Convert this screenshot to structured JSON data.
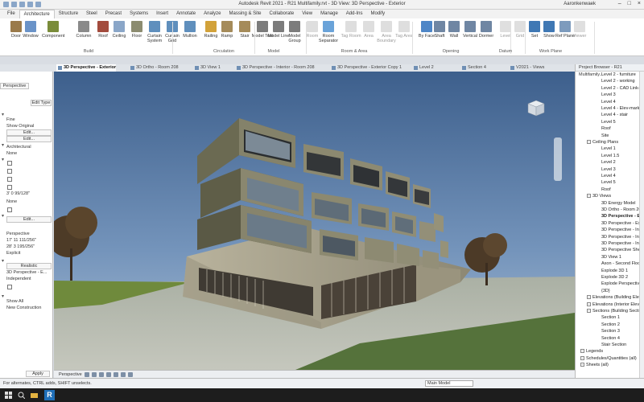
{
  "app": {
    "title": "Autodesk Revit 2021 - R21 Multifamily.rvt - 3D View: 3D Perspective - Exterior",
    "user": "Aaronkenwaek"
  },
  "ribbon_tabs": [
    "File",
    "Architecture",
    "Structure",
    "Steel",
    "Precast",
    "Systems",
    "Insert",
    "Annotate",
    "Analyze",
    "Massing & Site",
    "Collaborate",
    "View",
    "Manage",
    "Add-Ins",
    "Modify"
  ],
  "ribbon": {
    "buttons": [
      {
        "label": "Door"
      },
      {
        "label": "Window"
      },
      {
        "label": "Component"
      },
      {
        "label": "Column"
      },
      {
        "label": "Roof"
      },
      {
        "label": "Ceiling"
      },
      {
        "label": "Floor"
      },
      {
        "label": "Curtain System"
      },
      {
        "label": "Curtain Grid"
      },
      {
        "label": "Mullion"
      },
      {
        "label": "Railing"
      },
      {
        "label": "Ramp"
      },
      {
        "label": "Stair"
      },
      {
        "label": "Model Text"
      },
      {
        "label": "Model Line"
      },
      {
        "label": "Model Group"
      },
      {
        "label": "Room"
      },
      {
        "label": "Room Separator"
      },
      {
        "label": "Tag Room"
      },
      {
        "label": "Area"
      },
      {
        "label": "Area Boundary"
      },
      {
        "label": "Tag Area"
      },
      {
        "label": "By Face"
      },
      {
        "label": "Shaft"
      },
      {
        "label": "Wall"
      },
      {
        "label": "Vertical"
      },
      {
        "label": "Dormer"
      },
      {
        "label": "Level"
      },
      {
        "label": "Grid"
      },
      {
        "label": "Set"
      },
      {
        "label": "Show"
      },
      {
        "label": "Ref Plane"
      },
      {
        "label": "Viewer"
      }
    ],
    "panels": [
      "Build",
      "Circulation",
      "Model",
      "Room & Area",
      "Opening",
      "Datum",
      "Work Plane"
    ]
  },
  "view_tabs": [
    {
      "label": "3D Perspective - Exterior",
      "active": true
    },
    {
      "label": "3D Ortho - Room 208"
    },
    {
      "label": "3D View 1"
    },
    {
      "label": "3D Perspective - Interior - Room 208"
    },
    {
      "label": "3D Perspective - Exterior Copy 1"
    },
    {
      "label": "Level 2"
    },
    {
      "label": "Section 4"
    },
    {
      "label": "V2021 - Views"
    }
  ],
  "properties": {
    "type_label": "Perspective",
    "edit_type": "Edit Type",
    "rows": [
      "Fine",
      "Show Original",
      "Edit...",
      "Edit...",
      "Architectural",
      "None",
      "",
      "",
      "",
      "",
      "3' 0 99/128\"",
      "None",
      "",
      "Edit...",
      "Perspective",
      "17' 11 111/256\"",
      "28' 3 195/256\"",
      "Explicit",
      "Realistic",
      "3D Perspective - E...",
      "Independent",
      "",
      "Show All",
      "New Construction"
    ],
    "apply": "Apply"
  },
  "view_control": {
    "mode": "Perspective"
  },
  "project_browser": {
    "title": "Project Browser - R21 Multifamily...",
    "items": [
      {
        "label": "Level 2 - furniture",
        "indent": 4
      },
      {
        "label": "Level 2 - working",
        "indent": 4
      },
      {
        "label": "Level 2 - CAD Link-se",
        "indent": 4
      },
      {
        "label": "Level 3",
        "indent": 4
      },
      {
        "label": "Level 4",
        "indent": 4
      },
      {
        "label": "Level 4 - Elev-mark",
        "indent": 4
      },
      {
        "label": "Level 4 - stair",
        "indent": 4
      },
      {
        "label": "Level 5",
        "indent": 4
      },
      {
        "label": "Roof",
        "indent": 4
      },
      {
        "label": "Site",
        "indent": 4
      },
      {
        "label": "Ceiling Plans",
        "indent": 2,
        "group": true
      },
      {
        "label": "Level 1",
        "indent": 4
      },
      {
        "label": "Level 1.5",
        "indent": 4
      },
      {
        "label": "Level 2",
        "indent": 4
      },
      {
        "label": "Level 3",
        "indent": 4
      },
      {
        "label": "Level 4",
        "indent": 4
      },
      {
        "label": "Level 5",
        "indent": 4
      },
      {
        "label": "Roof",
        "indent": 4
      },
      {
        "label": "3D Views",
        "indent": 2,
        "group": true
      },
      {
        "label": "3D Energy Model",
        "indent": 4
      },
      {
        "label": "3D Ortho - Room 20",
        "indent": 4
      },
      {
        "label": "3D Perspective - Ex",
        "indent": 4,
        "bold": true
      },
      {
        "label": "3D Perspective - Ext",
        "indent": 4
      },
      {
        "label": "3D Perspective - Inte",
        "indent": 4
      },
      {
        "label": "3D Perspective - Inte",
        "indent": 4
      },
      {
        "label": "3D Perspective - Inte",
        "indent": 4
      },
      {
        "label": "3D Perspective Sheet",
        "indent": 4
      },
      {
        "label": "3D View 1",
        "indent": 4
      },
      {
        "label": "Axon - Second Floor",
        "indent": 4
      },
      {
        "label": "Explode 3D 1",
        "indent": 4
      },
      {
        "label": "Explode 3D 2",
        "indent": 4
      },
      {
        "label": "Explode Perspective",
        "indent": 4
      },
      {
        "label": "{3D}",
        "indent": 4
      },
      {
        "label": "Elevations (Building Elev",
        "indent": 2,
        "group": true
      },
      {
        "label": "Elevations (Interior Eleva",
        "indent": 2,
        "group": true
      },
      {
        "label": "Sections (Building Sectio",
        "indent": 2,
        "group": true
      },
      {
        "label": "Section 1",
        "indent": 4
      },
      {
        "label": "Section 2",
        "indent": 4
      },
      {
        "label": "Section 3",
        "indent": 4
      },
      {
        "label": "Section 4",
        "indent": 4
      },
      {
        "label": "Stair Section",
        "indent": 4
      },
      {
        "label": "Legends",
        "indent": 1,
        "group": true
      },
      {
        "label": "Schedules/Quantities (all)",
        "indent": 1,
        "group": true
      },
      {
        "label": "Sheets (all)",
        "indent": 1,
        "group": true
      }
    ]
  },
  "status": {
    "text": "For alternates, CTRL adds, SHIFT unselects.",
    "model": "Main Model",
    "coord": ":0"
  },
  "taskbar": {
    "app_letter": "R"
  },
  "colors": {
    "accent": "#1f6fb8",
    "sky": "#5d7da3",
    "ribbon_bg": "#ffffff"
  }
}
